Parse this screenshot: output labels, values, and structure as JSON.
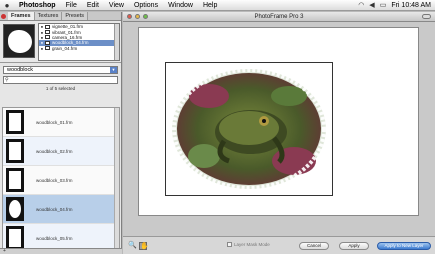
{
  "menubar": {
    "app": "Photoshop",
    "items": [
      "File",
      "Edit",
      "View",
      "Options",
      "Window",
      "Help"
    ],
    "clock": "Fri 10:48 AM"
  },
  "palette": {
    "tabs": [
      "Frames",
      "Textures",
      "Presets"
    ],
    "active_tab": "Frames",
    "layers": [
      "vignette_01.frm",
      "vibrant_01.frm",
      "camera_16.frm",
      "woodblock_04.frm",
      "grain_04.frm"
    ],
    "selected_layer": "woodblock_04.frm",
    "category": "woodblock",
    "search_placeholder": "",
    "count_text": "1 of 5 selected",
    "frames": [
      {
        "label": "woodblock_01.frm"
      },
      {
        "label": "woodblock_02.frm"
      },
      {
        "label": "woodblock_03.frm"
      },
      {
        "label": "woodblock_04.frm"
      },
      {
        "label": "woodblock_05.frm"
      }
    ],
    "selected_frame": "woodblock_04.frm"
  },
  "window": {
    "title": "PhotoFrame Pro 3"
  },
  "bottombar": {
    "mask_mode_label": "Layer Mask Mode",
    "cancel_label": "Cancel",
    "apply_label": "Apply",
    "apply_new_label": "Apply to New Layer"
  },
  "colors": {
    "accent": "#3d7bd0",
    "selection": "#b8cfe9"
  }
}
